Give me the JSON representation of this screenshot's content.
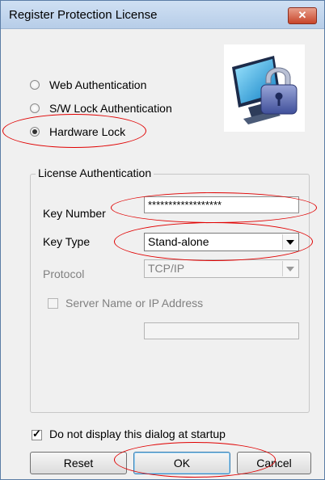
{
  "window": {
    "title": "Register Protection License",
    "close_glyph": "✕"
  },
  "auth_options": [
    {
      "label": "Web Authentication",
      "checked": false
    },
    {
      "label": "S/W Lock Authentication",
      "checked": false
    },
    {
      "label": "Hardware Lock",
      "checked": true
    }
  ],
  "license_group": {
    "legend": "License Authentication",
    "key_number_label": "Key Number",
    "key_number_value": "******************",
    "key_type_label": "Key Type",
    "key_type_value": "Stand-alone",
    "protocol_label": "Protocol",
    "protocol_value": "TCP/IP",
    "server_label": "Server Name or IP Address",
    "server_value": ""
  },
  "startup_checkbox": {
    "label": "Do not display this dialog at startup",
    "checked": true
  },
  "buttons": {
    "reset": "Reset",
    "ok": "OK",
    "cancel": "Cancel"
  },
  "colors": {
    "annotation": "#e00000",
    "title_bar": "#c3d7ee",
    "close_button": "#c8452a"
  }
}
